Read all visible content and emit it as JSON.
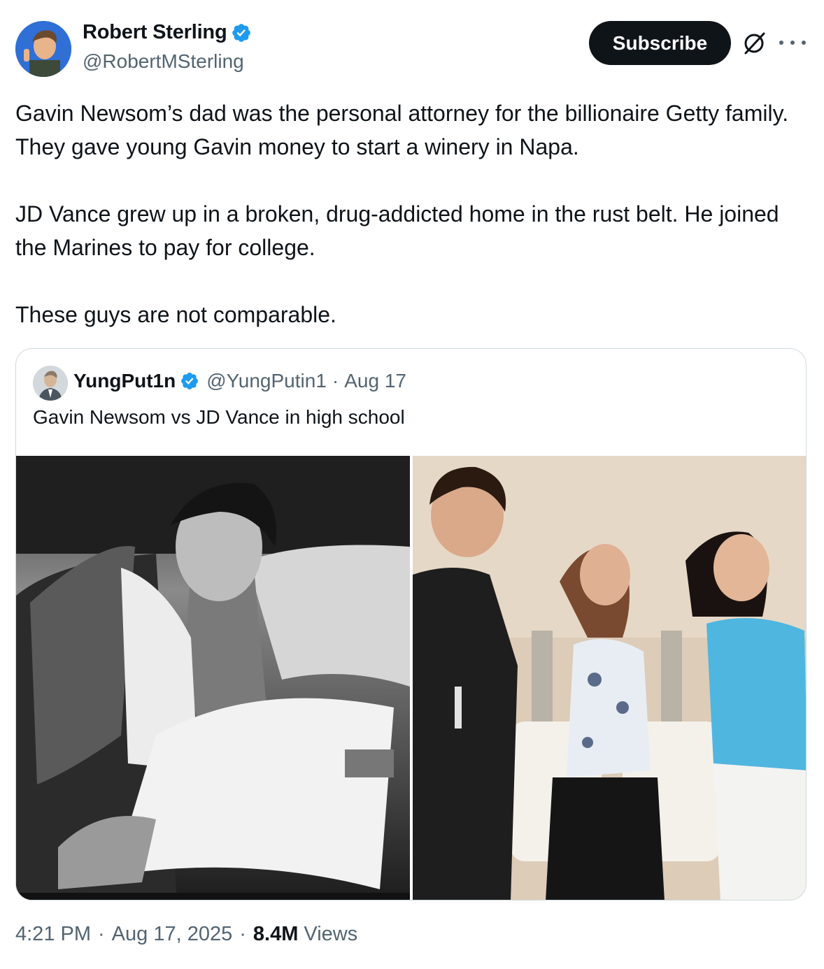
{
  "author": {
    "name": "Robert Sterling",
    "handle": "@RobertMSterling"
  },
  "actions": {
    "subscribe_label": "Subscribe"
  },
  "tweet": {
    "paragraphs": [
      "Gavin Newsom’s dad was the personal attorney for the billionaire Getty family. They gave young Gavin money to start a winery in Napa.",
      "JD Vance grew up in a broken, drug-addicted home in the rust belt. He joined the Marines to pay for college.",
      "These guys are not comparable."
    ]
  },
  "quote": {
    "name": "YungPut1n",
    "handle": "@YungPutin1",
    "separator": "·",
    "date": "Aug 17",
    "text": "Gavin Newsom vs JD Vance in high school"
  },
  "footer": {
    "time": "4:21 PM",
    "date": "Aug 17, 2025",
    "views_count": "8.4M",
    "views_label": "Views",
    "separator": "·"
  },
  "colors": {
    "accent_verified": "#1d9bf0",
    "text_primary": "#0f1419",
    "text_secondary": "#536471",
    "border": "#cfd9de",
    "button_bg": "#0f1419"
  },
  "icons": [
    "verified-badge-icon",
    "grok-icon",
    "more-icon"
  ]
}
